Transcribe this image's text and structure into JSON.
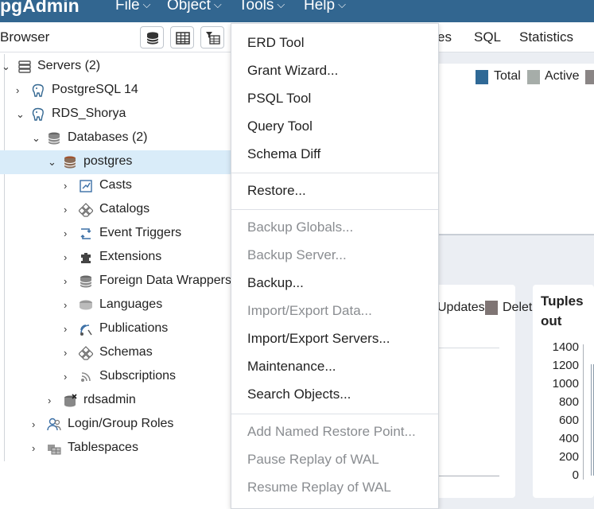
{
  "app": {
    "logo": "pgAdmin"
  },
  "menubar": [
    {
      "label": "File"
    },
    {
      "label": "Object"
    },
    {
      "label": "Tools"
    },
    {
      "label": "Help"
    }
  ],
  "browser": {
    "title": "Browser",
    "tree": [
      {
        "label": "Servers (2)",
        "icon": "servers-icon",
        "expanded": true
      },
      {
        "label": "PostgreSQL 14",
        "icon": "postgres-elephant-icon",
        "expanded": false
      },
      {
        "label": "RDS_Shorya",
        "icon": "postgres-elephant-icon",
        "expanded": true
      },
      {
        "label": "Databases (2)",
        "icon": "databases-icon",
        "expanded": true
      },
      {
        "label": "postgres",
        "icon": "database-icon",
        "expanded": true,
        "selected": true
      },
      {
        "label": "Casts",
        "icon": "casts-icon",
        "expanded": false
      },
      {
        "label": "Catalogs",
        "icon": "catalogs-icon",
        "expanded": false
      },
      {
        "label": "Event Triggers",
        "icon": "event-triggers-icon",
        "expanded": false
      },
      {
        "label": "Extensions",
        "icon": "extensions-icon",
        "expanded": false
      },
      {
        "label": "Foreign Data Wrappers",
        "icon": "foreign-data-wrappers-icon",
        "expanded": false
      },
      {
        "label": "Languages",
        "icon": "languages-icon",
        "expanded": false
      },
      {
        "label": "Publications",
        "icon": "publications-icon",
        "expanded": false
      },
      {
        "label": "Schemas",
        "icon": "schemas-icon",
        "expanded": false
      },
      {
        "label": "Subscriptions",
        "icon": "subscriptions-icon",
        "expanded": false
      },
      {
        "label": "rdsadmin",
        "icon": "database-disconnected-icon",
        "expanded": false
      },
      {
        "label": "Login/Group Roles",
        "icon": "login-roles-icon",
        "expanded": false
      },
      {
        "label": "Tablespaces",
        "icon": "tablespaces-icon",
        "expanded": false
      }
    ]
  },
  "main_tabs": [
    {
      "label": "es"
    },
    {
      "label": "SQL"
    },
    {
      "label": "Statistics"
    }
  ],
  "dashboard": {
    "legend_top": [
      {
        "label": "Total",
        "color": "#2f6996"
      },
      {
        "label": "Active",
        "color": "#a6ada9"
      }
    ],
    "legend_mid": [
      {
        "label": "Updates",
        "color": "#7f7574"
      },
      {
        "label": "Delet"
      }
    ],
    "tuples_title": "Tuples out",
    "tuples_yticks": [
      "1400",
      "1200",
      "1000",
      "800",
      "600",
      "400",
      "200",
      "0"
    ]
  },
  "tools_menu": [
    {
      "label": "ERD Tool",
      "enabled": true
    },
    {
      "label": "Grant Wizard...",
      "enabled": true
    },
    {
      "label": "PSQL Tool",
      "enabled": true
    },
    {
      "label": "Query Tool",
      "enabled": true
    },
    {
      "label": "Schema Diff",
      "enabled": true
    },
    {
      "label": "Restore...",
      "enabled": true
    },
    {
      "label": "Backup Globals...",
      "enabled": false
    },
    {
      "label": "Backup Server...",
      "enabled": false
    },
    {
      "label": "Backup...",
      "enabled": true
    },
    {
      "label": "Import/Export Data...",
      "enabled": false
    },
    {
      "label": "Import/Export Servers...",
      "enabled": true
    },
    {
      "label": "Maintenance...",
      "enabled": true
    },
    {
      "label": "Search Objects...",
      "enabled": true
    },
    {
      "label": "Add Named Restore Point...",
      "enabled": false
    },
    {
      "label": "Pause Replay of WAL",
      "enabled": false
    },
    {
      "label": "Resume Replay of WAL",
      "enabled": false
    }
  ]
}
